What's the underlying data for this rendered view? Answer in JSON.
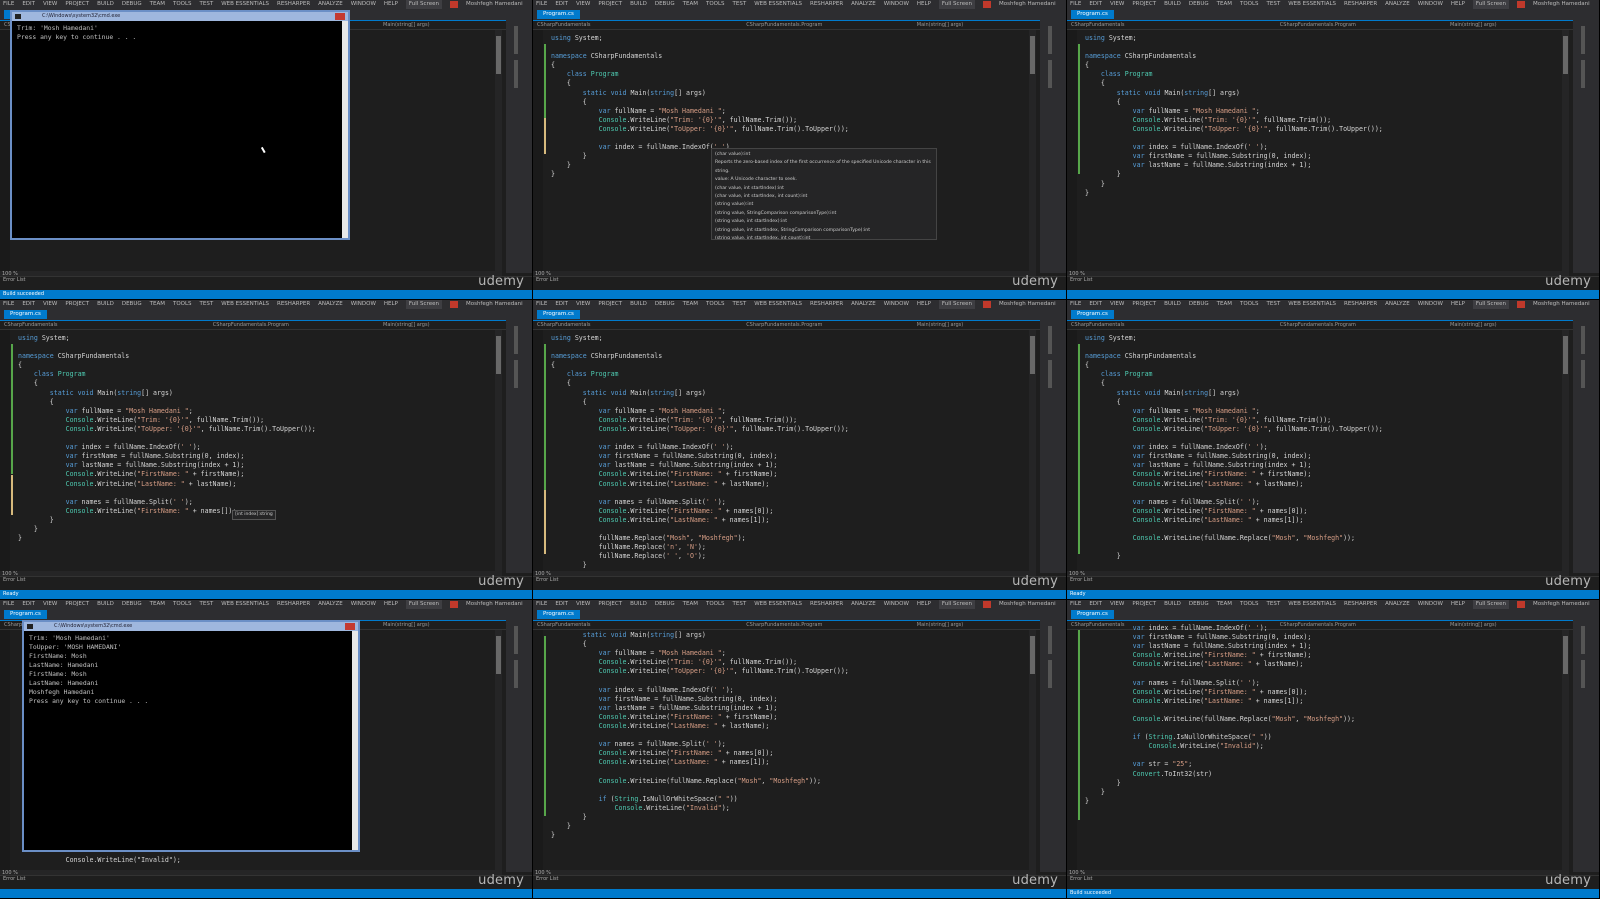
{
  "menu": [
    "FILE",
    "EDIT",
    "VIEW",
    "PROJECT",
    "BUILD",
    "DEBUG",
    "TEAM",
    "TOOLS",
    "TEST",
    "WEB ESSENTIALS",
    "RESHARPER",
    "ANALYZE",
    "WINDOW",
    "HELP"
  ],
  "fullscreen": "Full Screen",
  "user": "Moshfegh Hamedani",
  "tab": "Program.cs",
  "nav": {
    "project": "CSharpFundamentals",
    "class": "CSharpFundamentals.Program",
    "method": "Main(string[] args)"
  },
  "zoom": "100 %",
  "error_list": "Error List",
  "watermark": "udemy",
  "status": {
    "p1": "Build succeeded",
    "p4": "Ready",
    "p6": "Ready",
    "p9": "Build succeeded"
  },
  "p1": {
    "console_title": "C:\\Windows\\system32\\cmd.exe",
    "console": "Trim: 'Mosh Hamedani'\nPress any key to continue . . ."
  },
  "p2": {
    "lines": [
      "using System;",
      "",
      "namespace CSharpFundamentals",
      "{",
      "    class Program",
      "    {",
      "        static void Main(string[] args)",
      "        {",
      "            var fullName = \"Mosh Hamedani \";",
      "            Console.WriteLine(\"Trim: '{0}'\", fullName.Trim());",
      "            Console.WriteLine(\"ToUpper: '{0}'\", fullName.Trim().ToUpper());",
      "",
      "            var index = fullName.IndexOf(' ')",
      "        }",
      "    }",
      "}"
    ],
    "intellisense": [
      "(char value):int",
      "Reports the zero-based index of the first occurrence of the specified Unicode character in this string.",
      "value: A Unicode character to seek.",
      "(char value, int startIndex):int",
      "(char value, int startIndex, int count):int",
      "(string value):int",
      "(string value, StringComparison comparisonType):int",
      "(string value, int startIndex):int",
      "(string value, int startIndex, StringComparison comparisonType):int",
      "(string value, int startIndex, int count):int",
      "(string value, int startIndex, int count, StringComparison comparisonType):int"
    ]
  },
  "p3": {
    "lines": [
      "using System;",
      "",
      "namespace CSharpFundamentals",
      "{",
      "    class Program",
      "    {",
      "        static void Main(string[] args)",
      "        {",
      "            var fullName = \"Mosh Hamedani \";",
      "            Console.WriteLine(\"Trim: '{0}'\", fullName.Trim());",
      "            Console.WriteLine(\"ToUpper: '{0}'\", fullName.Trim().ToUpper());",
      "",
      "            var index = fullName.IndexOf(' ');",
      "            var firstName = fullName.Substring(0, index);",
      "            var lastName = fullName.Substring(index + 1);",
      "        }",
      "    }",
      "}"
    ]
  },
  "p4": {
    "lines": [
      "using System;",
      "",
      "namespace CSharpFundamentals",
      "{",
      "    class Program",
      "    {",
      "        static void Main(string[] args)",
      "        {",
      "            var fullName = \"Mosh Hamedani \";",
      "            Console.WriteLine(\"Trim: '{0}'\", fullName.Trim());",
      "            Console.WriteLine(\"ToUpper: '{0}'\", fullName.Trim().ToUpper());",
      "",
      "            var index = fullName.IndexOf(' ');",
      "            var firstName = fullName.Substring(0, index);",
      "            var lastName = fullName.Substring(index + 1);",
      "            Console.WriteLine(\"FirstName: \" + firstName);",
      "            Console.WriteLine(\"LastName: \" + lastName);",
      "",
      "            var names = fullName.Split(' ');",
      "            Console.WriteLine(\"FirstName: \" + names[]);",
      "        }",
      "    }",
      "}"
    ],
    "hint": "[int index]:string"
  },
  "p5": {
    "lines": [
      "using System;",
      "",
      "namespace CSharpFundamentals",
      "{",
      "    class Program",
      "    {",
      "        static void Main(string[] args)",
      "        {",
      "            var fullName = \"Mosh Hamedani \";",
      "            Console.WriteLine(\"Trim: '{0}'\", fullName.Trim());",
      "            Console.WriteLine(\"ToUpper: '{0}'\", fullName.Trim().ToUpper());",
      "",
      "            var index = fullName.IndexOf(' ');",
      "            var firstName = fullName.Substring(0, index);",
      "            var lastName = fullName.Substring(index + 1);",
      "            Console.WriteLine(\"FirstName: \" + firstName);",
      "            Console.WriteLine(\"LastName: \" + lastName);",
      "",
      "            var names = fullName.Split(' ');",
      "            Console.WriteLine(\"FirstName: \" + names[0]);",
      "            Console.WriteLine(\"LastName: \" + names[1]);",
      "",
      "            fullName.Replace(\"Mosh\", \"Moshfegh\");",
      "            fullName.Replace('n', 'N');",
      "            fullName.Replace(' ', 'O');",
      "        }"
    ]
  },
  "p6": {
    "lines": [
      "using System;",
      "",
      "namespace CSharpFundamentals",
      "{",
      "    class Program",
      "    {",
      "        static void Main(string[] args)",
      "        {",
      "            var fullName = \"Mosh Hamedani \";",
      "            Console.WriteLine(\"Trim: '{0}'\", fullName.Trim());",
      "            Console.WriteLine(\"ToUpper: '{0}'\", fullName.Trim().ToUpper());",
      "",
      "            var index = fullName.IndexOf(' ');",
      "            var firstName = fullName.Substring(0, index);",
      "            var lastName = fullName.Substring(index + 1);",
      "            Console.WriteLine(\"FirstName: \" + firstName);",
      "            Console.WriteLine(\"LastName: \" + lastName);",
      "",
      "            var names = fullName.Split(' ');",
      "            Console.WriteLine(\"FirstName: \" + names[0]);",
      "            Console.WriteLine(\"LastName: \" + names[1]);",
      "",
      "            Console.WriteLine(fullName.Replace(\"Mosh\", \"Moshfegh\"));",
      "",
      "        }"
    ]
  },
  "p7": {
    "console_title": "C:\\Windows\\system32\\cmd.exe",
    "console": "Trim: 'Mosh Hamedani'\nToUpper: 'MOSH HAMEDANI'\nFirstName: Mosh\nLastName: Hamedani\nFirstName: Mosh\nLastName: Hamedani\nMoshfegh Hamedani\nPress any key to continue . . .",
    "below": "            Console.WriteLine(\"Invalid\");"
  },
  "p8": {
    "lines": [
      "        static void Main(string[] args)",
      "        {",
      "            var fullName = \"Mosh Hamedani \";",
      "            Console.WriteLine(\"Trim: '{0}'\", fullName.Trim());",
      "            Console.WriteLine(\"ToUpper: '{0}'\", fullName.Trim().ToUpper());",
      "",
      "            var index = fullName.IndexOf(' ');",
      "            var firstName = fullName.Substring(0, index);",
      "            var lastName = fullName.Substring(index + 1);",
      "            Console.WriteLine(\"FirstName: \" + firstName);",
      "            Console.WriteLine(\"LastName: \" + lastName);",
      "",
      "            var names = fullName.Split(' ');",
      "            Console.WriteLine(\"FirstName: \" + names[0]);",
      "            Console.WriteLine(\"LastName: \" + names[1]);",
      "",
      "            Console.WriteLine(fullName.Replace(\"Mosh\", \"Moshfegh\"));",
      "",
      "            if (String.IsNullOrWhiteSpace(\" \"))",
      "                Console.WriteLine(\"Invalid\");",
      "        }",
      "    }",
      "}"
    ]
  },
  "p9": {
    "lines": [
      "            var index = fullName.IndexOf(' ');",
      "            var firstName = fullName.Substring(0, index);",
      "            var lastName = fullName.Substring(index + 1);",
      "            Console.WriteLine(\"FirstName: \" + firstName);",
      "            Console.WriteLine(\"LastName: \" + lastName);",
      "",
      "            var names = fullName.Split(' ');",
      "            Console.WriteLine(\"FirstName: \" + names[0]);",
      "            Console.WriteLine(\"LastName: \" + names[1]);",
      "",
      "            Console.WriteLine(fullName.Replace(\"Mosh\", \"Moshfegh\"));",
      "",
      "            if (String.IsNullOrWhiteSpace(\" \"))",
      "                Console.WriteLine(\"Invalid\");",
      "",
      "            var str = \"25\";",
      "            Convert.ToInt32(str)",
      "        }",
      "    }",
      "}"
    ]
  }
}
